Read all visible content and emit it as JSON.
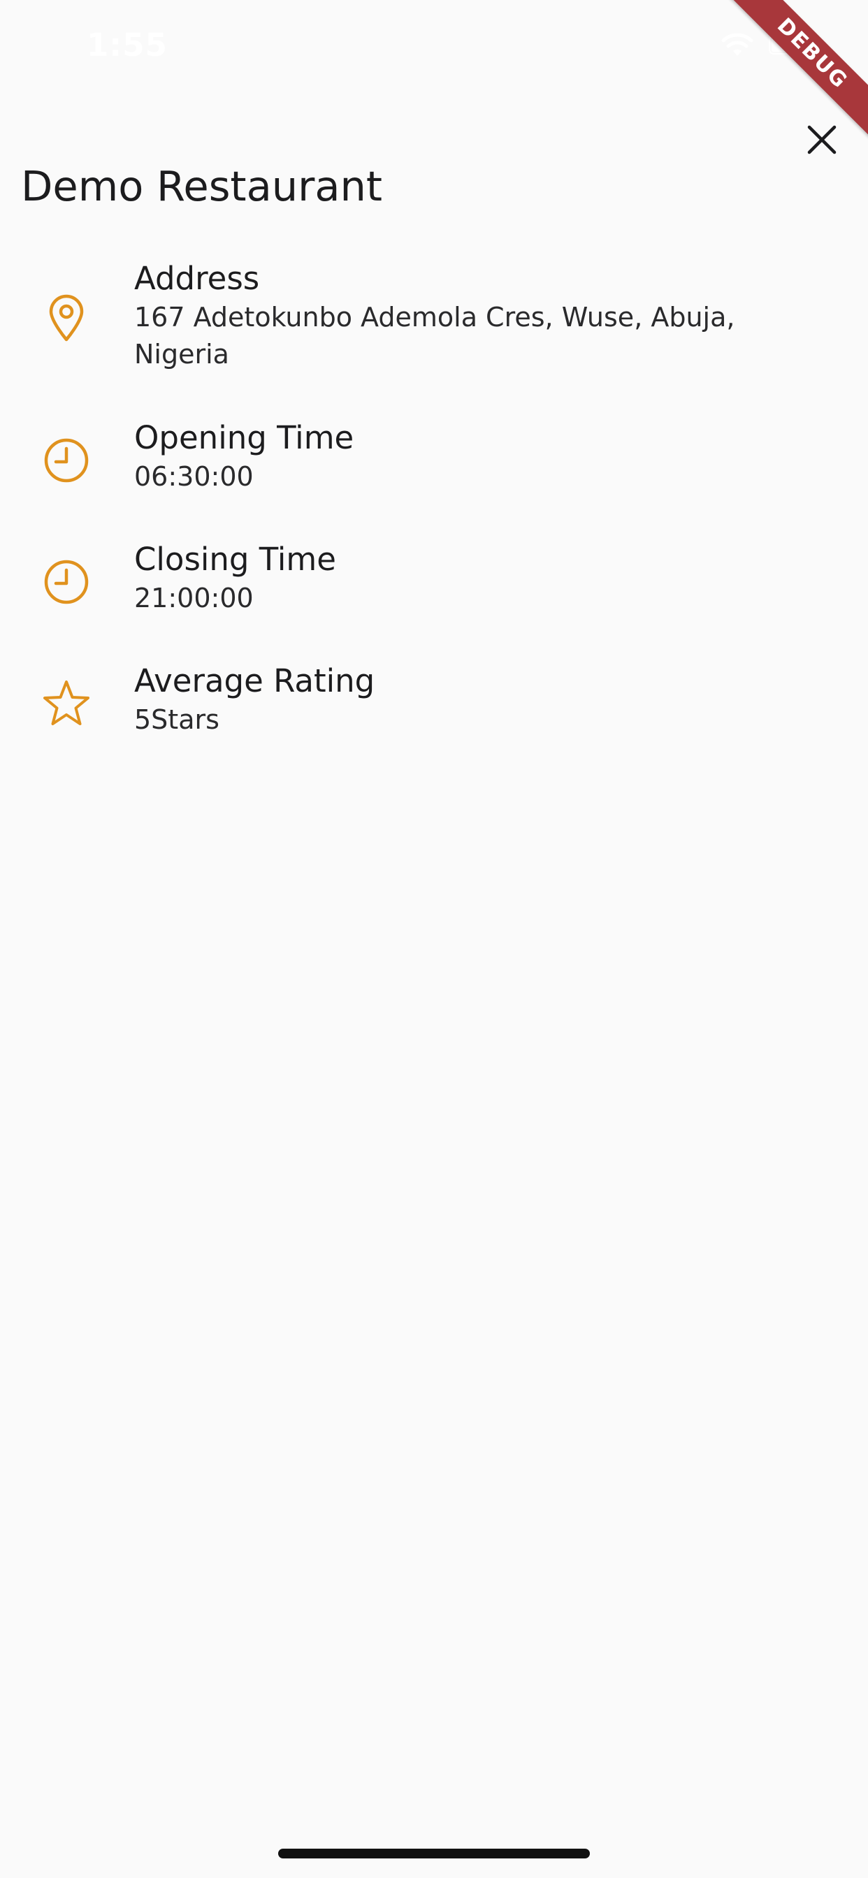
{
  "status_bar": {
    "time": "1:55"
  },
  "debug_banner": {
    "label": "DEBUG"
  },
  "page": {
    "title": "Demo Restaurant"
  },
  "details": [
    {
      "icon": "location-pin-icon",
      "title": "Address",
      "value": "167 Adetokunbo Ademola Cres, Wuse, Abuja, Nigeria"
    },
    {
      "icon": "clock-icon",
      "title": "Opening Time",
      "value": "06:30:00"
    },
    {
      "icon": "clock-icon",
      "title": "Closing Time",
      "value": "21:00:00"
    },
    {
      "icon": "star-icon",
      "title": "Average Rating",
      "value": "5Stars"
    }
  ],
  "colors": {
    "accent": "#e0921e",
    "background": "#fafafa",
    "text": "#1c1c1e",
    "debug_ribbon": "#a8373b"
  }
}
